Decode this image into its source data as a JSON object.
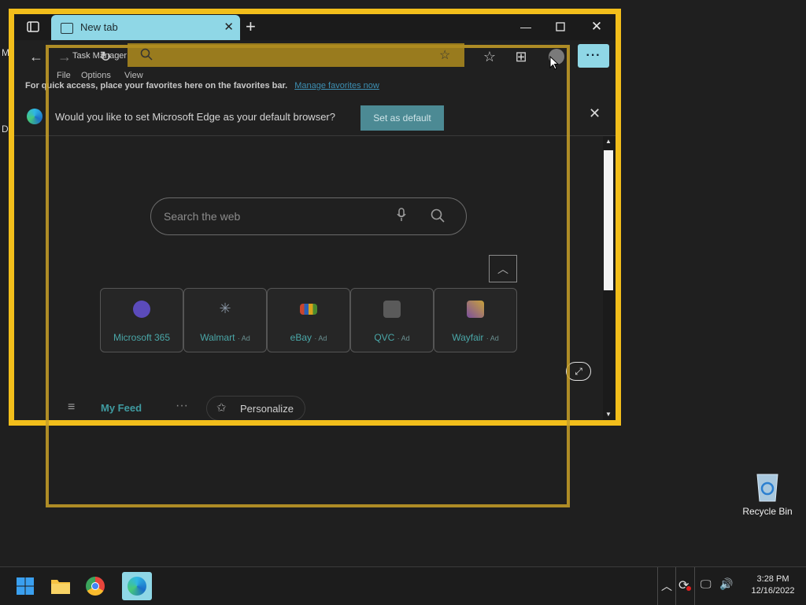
{
  "desktop": {
    "left_letters": [
      "M",
      "D"
    ],
    "recycle_bin_label": "Recycle Bin"
  },
  "edge": {
    "tab_title": "New tab",
    "favbar_text": "For quick access, place your favorites here on the favorites bar.",
    "favbar_link": "Manage favorites now",
    "infobar_message": "Would you like to set Microsoft Edge as your default browser?",
    "set_default_label": "Set as default",
    "search_placeholder": "Search the web",
    "tiles": [
      {
        "label": "Microsoft 365",
        "ad": "",
        "color": "#5b4bbb"
      },
      {
        "label": "Walmart",
        "ad": "· Ad",
        "color": "#6c7a8a"
      },
      {
        "label": "eBay",
        "ad": "· Ad",
        "color": "#c9452e"
      },
      {
        "label": "QVC",
        "ad": "· Ad",
        "color": "#8c8c8c"
      },
      {
        "label": "Wayfair",
        "ad": "· Ad",
        "color": "#7b4f9e"
      }
    ],
    "feed": {
      "my_feed_label": "My Feed",
      "personalize_label": "Personalize"
    }
  },
  "task_manager": {
    "title": "Task Manager",
    "menu": [
      "File",
      "Options",
      "View"
    ]
  },
  "taskbar": {
    "time": "3:28 PM",
    "date": "12/16/2022"
  },
  "colors": {
    "accent_yellow": "#f2be1b",
    "edge_tab": "#8fd7e6",
    "set_default_bg": "#4c8a94"
  }
}
